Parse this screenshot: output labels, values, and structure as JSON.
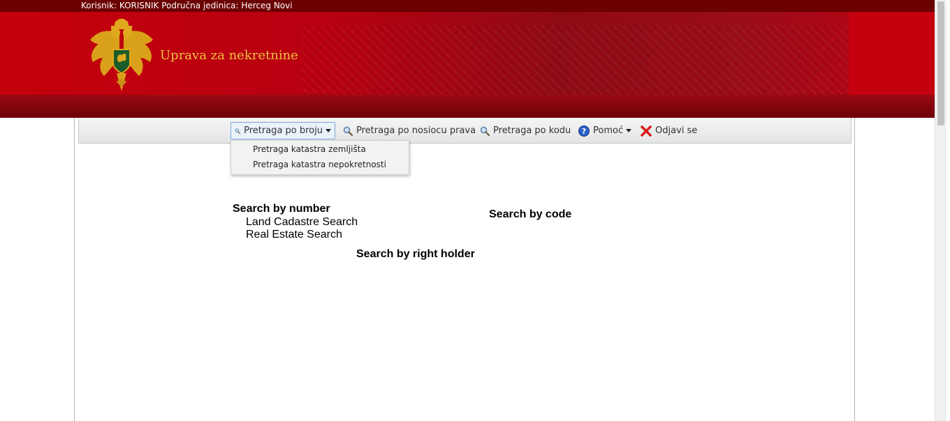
{
  "userbar": {
    "text": "Korisnik: KORISNIK Područna jedinica: Herceg Novi"
  },
  "header": {
    "brand": "Uprava za nekretnine"
  },
  "toolbar": {
    "search_by_number": "Pretraga po broju",
    "search_by_holder": "Pretraga po nosiocu prava",
    "search_by_code": "Pretraga po kodu",
    "help": "Pomoć",
    "logout": "Odjavi se"
  },
  "dropdown": {
    "items": [
      "Pretraga katastra zemljišta",
      "Pretraga katastra nepokretnosti"
    ]
  },
  "content": {
    "search_by_number": "Search by number",
    "land_cadastre": "Land Cadastre Search",
    "real_estate": "Real Estate Search",
    "search_by_code": "Search by code",
    "search_by_right_holder": "Search by right holder"
  },
  "colors": {
    "banner_red": "#c4000c",
    "dark_red": "#6b0000",
    "brand_gold": "#f0c040"
  },
  "icons": [
    "montenegro-coat-of-arms-icon",
    "magnifier-icon",
    "help-icon",
    "close-icon",
    "caret-down-icon"
  ]
}
